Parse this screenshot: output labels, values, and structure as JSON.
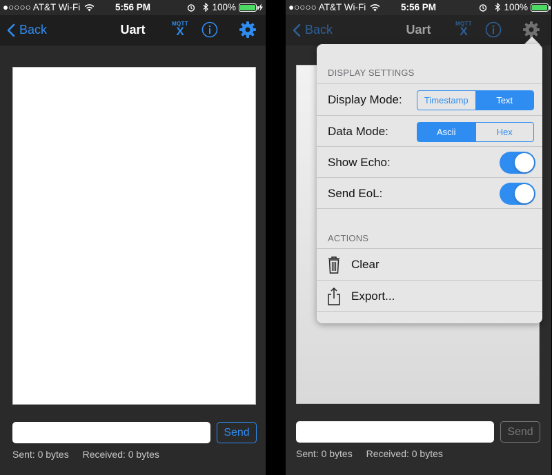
{
  "status": {
    "carrier": "●○○○○ AT&T Wi-Fi",
    "time": "5:56 PM",
    "battery": "100%",
    "battery_level": 1.0
  },
  "nav": {
    "back": "Back",
    "title": "Uart",
    "mqtt_top": "MQTT",
    "mqtt_bottom": "X"
  },
  "colors": {
    "accent": "#2f8cf0",
    "battery_green": "#4cd964"
  },
  "input": {
    "value": "",
    "placeholder": ""
  },
  "send": "Send",
  "stats": {
    "sent": "Sent: 0 bytes",
    "received": "Received: 0 bytes"
  },
  "popover": {
    "display_settings_header": "DISPLAY SETTINGS",
    "display_mode_label": "Display Mode:",
    "display_mode_options": [
      "Timestamp",
      "Text"
    ],
    "display_mode_selected": "Text",
    "data_mode_label": "Data Mode:",
    "data_mode_options": [
      "Ascii",
      "Hex"
    ],
    "data_mode_selected": "Ascii",
    "show_echo_label": "Show Echo:",
    "show_echo": true,
    "send_eol_label": "Send EoL:",
    "send_eol": true,
    "actions_header": "ACTIONS",
    "clear_label": "Clear",
    "export_label": "Export..."
  },
  "icons": [
    "back-chevron-icon",
    "mqtt-icon",
    "info-icon",
    "gear-icon",
    "wifi-icon",
    "bluetooth-icon",
    "alarm-icon",
    "battery-icon",
    "trash-icon",
    "share-icon"
  ]
}
